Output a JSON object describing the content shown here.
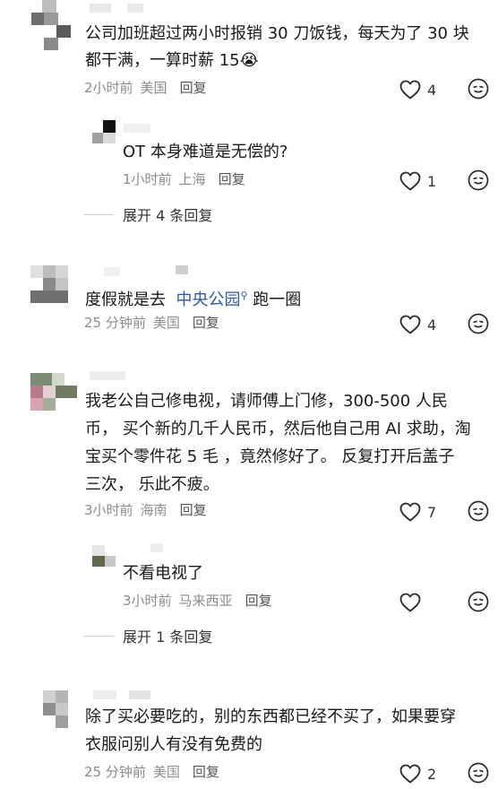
{
  "comments": [
    {
      "text_lines": [
        "公司加班超过两小时报销 30 刀饭钱，每天为了 30 块",
        "都干满，一算时薪 15"
      ],
      "time": "2小时前",
      "location": "美国",
      "reply_label": "回复",
      "likes": "4",
      "sub_reply": {
        "text": "OT 本身难道是无偿的?",
        "time": "1小时前",
        "location": "上海",
        "reply_label": "回复",
        "likes": "1"
      },
      "expand_label": "展开 4 条回复"
    },
    {
      "text_prefix": "度假就是去",
      "text_link": "中央公园",
      "text_suffix": "跑一圈",
      "time": "25 分钟前",
      "location": "美国",
      "reply_label": "回复",
      "likes": "4"
    },
    {
      "text_lines": [
        "我老公自己修电视，请师傅上门修，300-500 人民",
        "币， 买个新的几千人民币，然后他自己用 AI 求助，淘",
        "宝买个零件花 5 毛 ，竟然修好了。 反复打开后盖子",
        "三次， 乐此不疲。"
      ],
      "time": "3小时前",
      "location": "海南",
      "reply_label": "回复",
      "likes": "7",
      "sub_reply": {
        "text": "不看电视了",
        "time": "3小时前",
        "location": "马来西亚",
        "reply_label": "回复",
        "likes": ""
      },
      "expand_label": "展开 1 条回复"
    },
    {
      "text_lines": [
        "除了买必要吃的，别的东西都已经不买了，如果要穿",
        "衣服问别人有没有免费的"
      ],
      "time": "25 分钟前",
      "location": "美国",
      "reply_label": "回复",
      "likes": "2"
    }
  ],
  "icons": {
    "like": "heart-outline-icon",
    "emoji": "face-smile-icon"
  },
  "colors": {
    "link": "#2b5aa6",
    "meta": "#8c8c8c",
    "text": "#1a1a1a"
  }
}
